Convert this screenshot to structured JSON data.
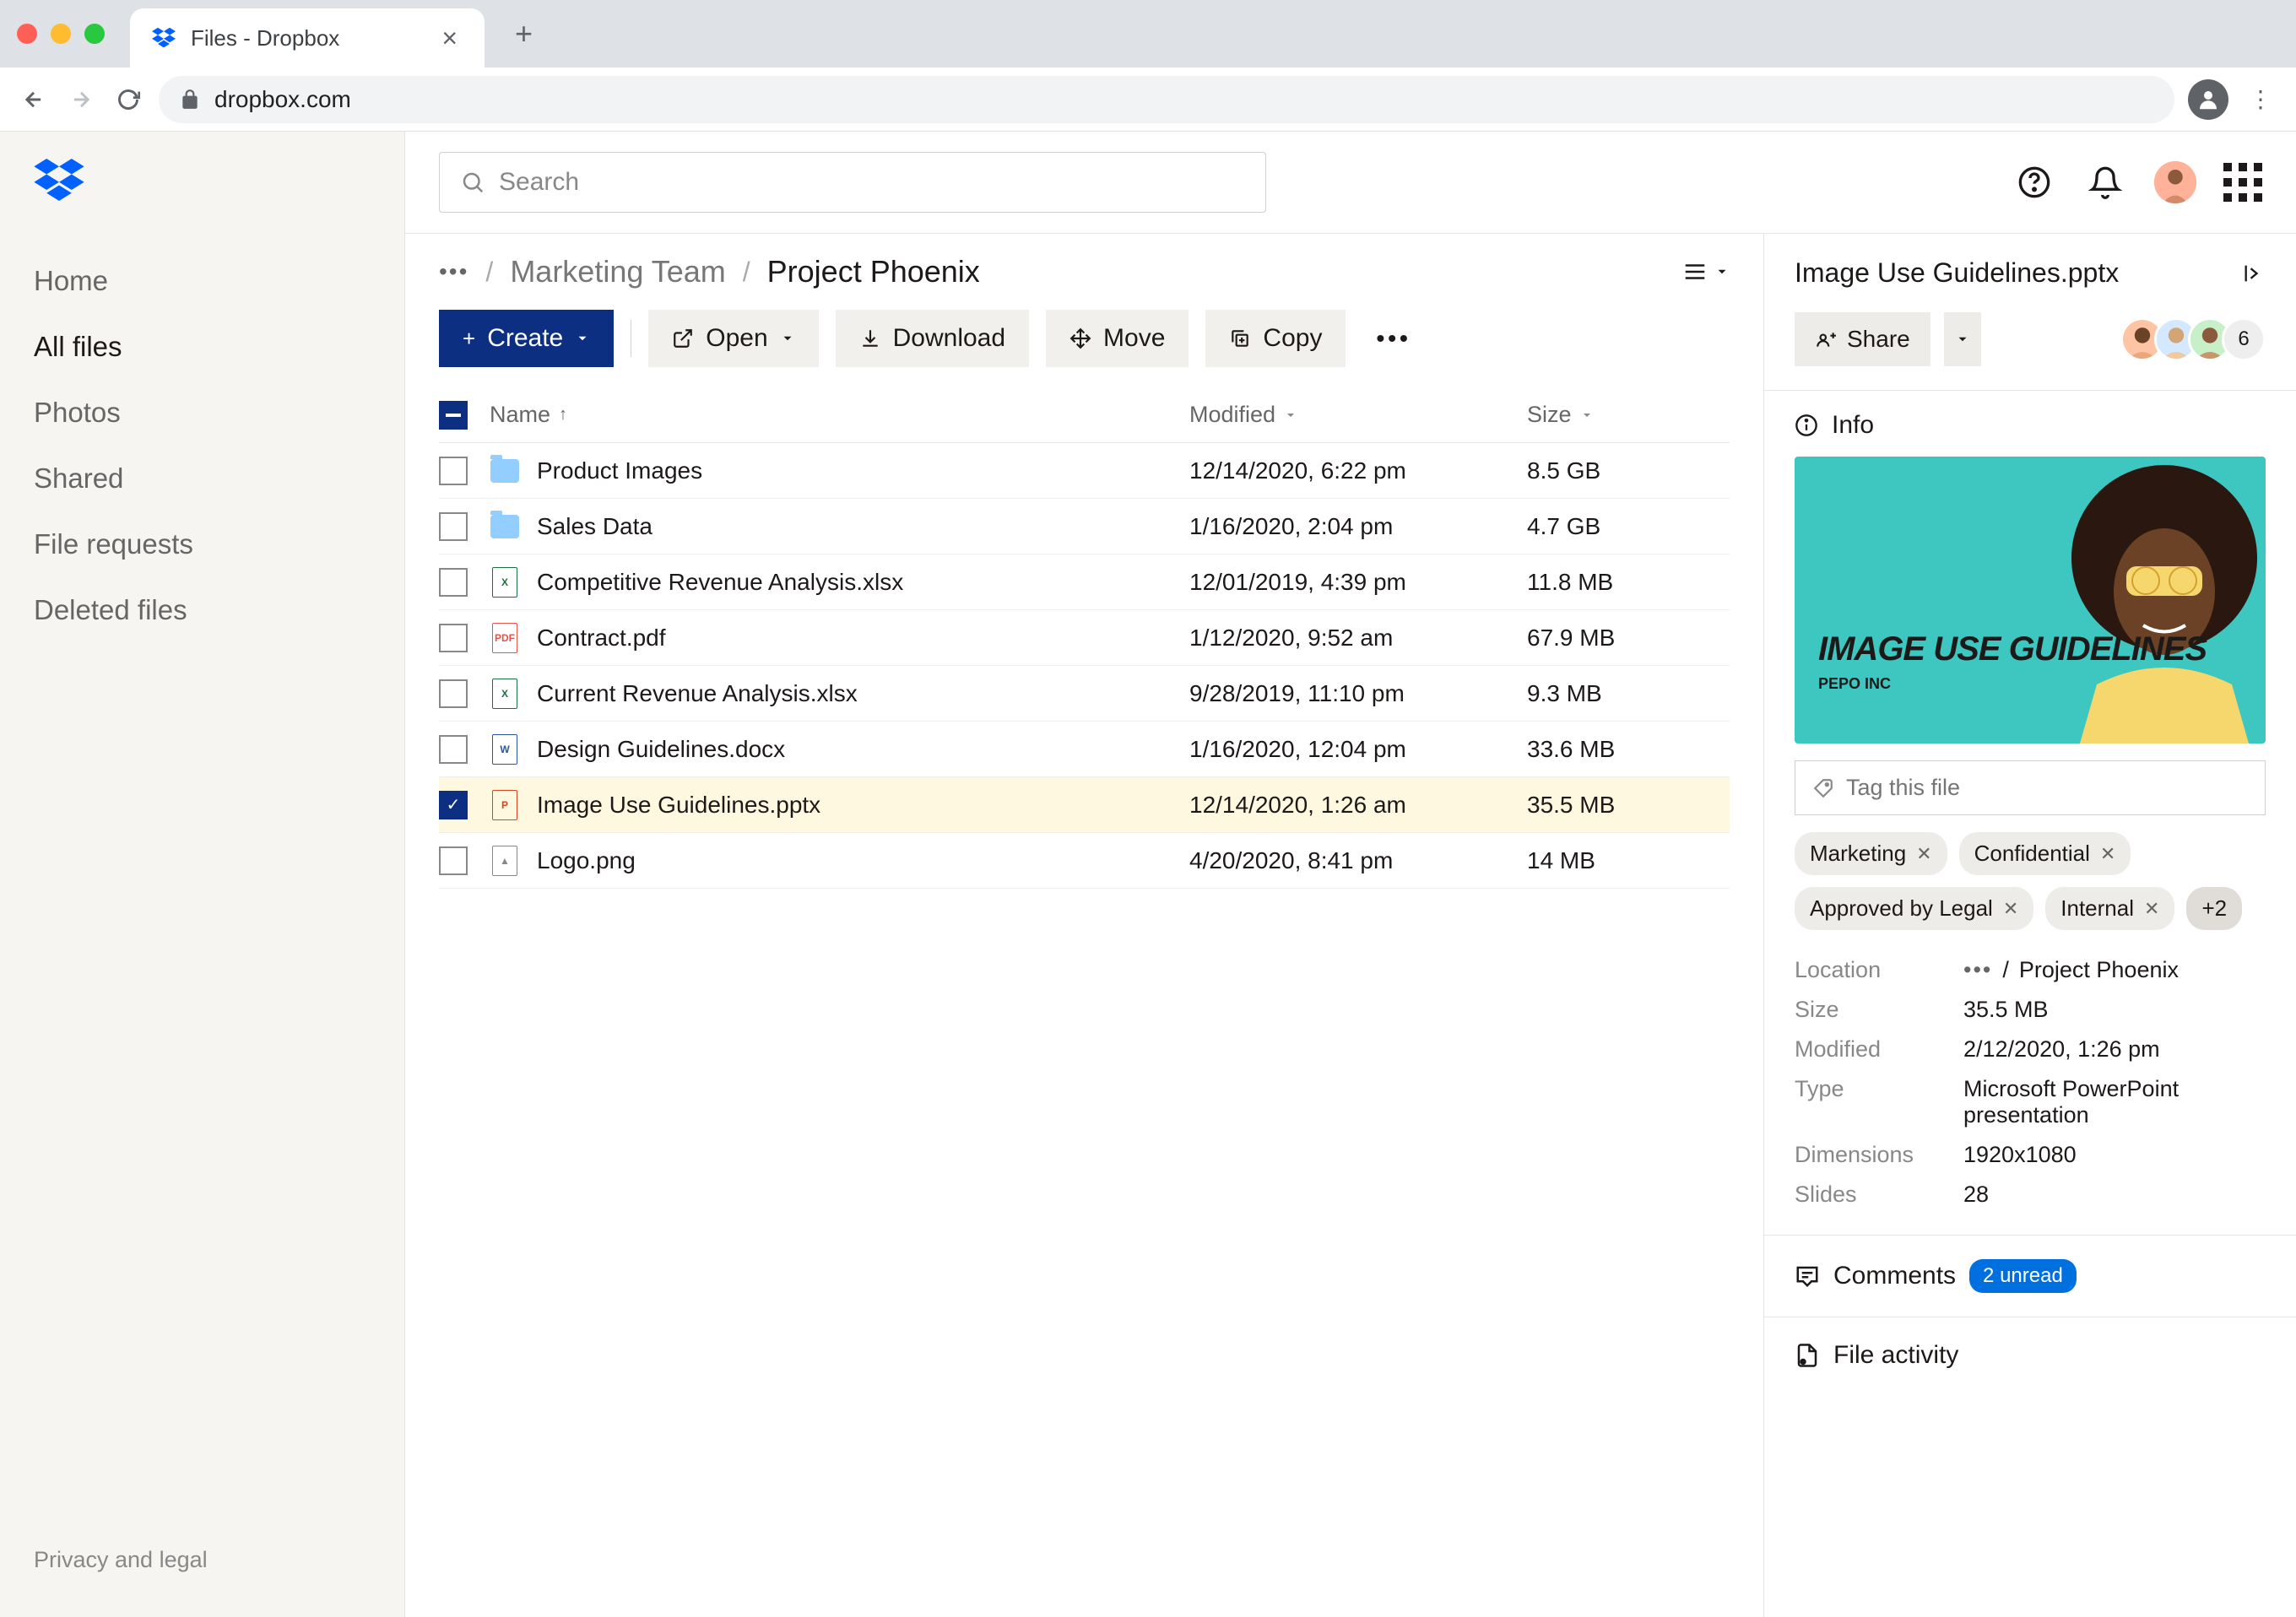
{
  "browser": {
    "tab_title": "Files - Dropbox",
    "url": "dropbox.com"
  },
  "search": {
    "placeholder": "Search"
  },
  "sidebar": {
    "items": [
      {
        "label": "Home",
        "active": false
      },
      {
        "label": "All files",
        "active": true
      },
      {
        "label": "Photos",
        "active": false
      },
      {
        "label": "Shared",
        "active": false
      },
      {
        "label": "File requests",
        "active": false
      },
      {
        "label": "Deleted files",
        "active": false
      }
    ],
    "footer": "Privacy and legal"
  },
  "breadcrumb": {
    "parent": "Marketing Team",
    "current": "Project Phoenix"
  },
  "toolbar": {
    "create": "Create",
    "open": "Open",
    "download": "Download",
    "move": "Move",
    "copy": "Copy"
  },
  "columns": {
    "name": "Name",
    "modified": "Modified",
    "size": "Size"
  },
  "files": [
    {
      "type": "folder",
      "name": "Product Images",
      "modified": "12/14/2020, 6:22 pm",
      "size": "8.5 GB",
      "checked": false
    },
    {
      "type": "folder",
      "name": "Sales Data",
      "modified": "1/16/2020, 2:04 pm",
      "size": "4.7 GB",
      "checked": false
    },
    {
      "type": "xlsx",
      "name": "Competitive Revenue Analysis.xlsx",
      "modified": "12/01/2019, 4:39 pm",
      "size": "11.8 MB",
      "checked": false
    },
    {
      "type": "pdf",
      "name": "Contract.pdf",
      "modified": "1/12/2020, 9:52 am",
      "size": "67.9 MB",
      "checked": false
    },
    {
      "type": "xlsx",
      "name": "Current Revenue Analysis.xlsx",
      "modified": "9/28/2019, 11:10 pm",
      "size": "9.3 MB",
      "checked": false
    },
    {
      "type": "docx",
      "name": "Design Guidelines.docx",
      "modified": "1/16/2020, 12:04 pm",
      "size": "33.6 MB",
      "checked": false
    },
    {
      "type": "pptx",
      "name": "Image Use Guidelines.pptx",
      "modified": "12/14/2020, 1:26 am",
      "size": "35.5 MB",
      "checked": true
    },
    {
      "type": "png",
      "name": "Logo.png",
      "modified": "4/20/2020, 8:41 pm",
      "size": "14 MB",
      "checked": false
    }
  ],
  "details": {
    "title": "Image Use Guidelines.pptx",
    "share_label": "Share",
    "more_avatars": "6",
    "info_heading": "Info",
    "preview_title": "IMAGE USE GUIDELINES",
    "preview_sub": "PEPO INC",
    "tag_placeholder": "Tag this file",
    "tags": [
      "Marketing",
      "Confidential",
      "Approved by Legal",
      "Internal"
    ],
    "tags_more": "+2",
    "meta": {
      "location_label": "Location",
      "location_value": "Project Phoenix",
      "size_label": "Size",
      "size_value": "35.5 MB",
      "modified_label": "Modified",
      "modified_value": "2/12/2020, 1:26 pm",
      "type_label": "Type",
      "type_value": "Microsoft PowerPoint presentation",
      "dimensions_label": "Dimensions",
      "dimensions_value": "1920x1080",
      "slides_label": "Slides",
      "slides_value": "28"
    },
    "comments_label": "Comments",
    "comments_badge": "2 unread",
    "activity_label": "File activity"
  }
}
